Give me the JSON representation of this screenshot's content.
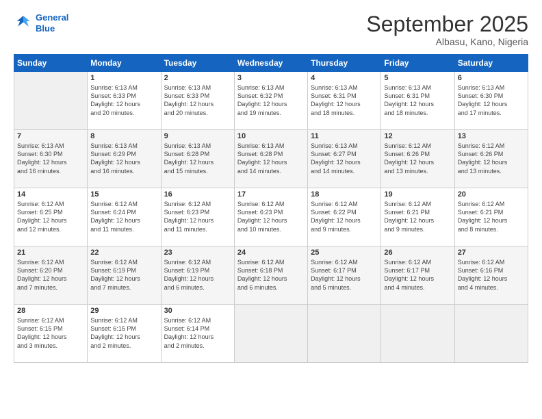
{
  "header": {
    "logo_line1": "General",
    "logo_line2": "Blue",
    "title": "September 2025",
    "location": "Albasu, Kano, Nigeria"
  },
  "days_of_week": [
    "Sunday",
    "Monday",
    "Tuesday",
    "Wednesday",
    "Thursday",
    "Friday",
    "Saturday"
  ],
  "weeks": [
    [
      {
        "day": "",
        "info": ""
      },
      {
        "day": "1",
        "info": "Sunrise: 6:13 AM\nSunset: 6:33 PM\nDaylight: 12 hours\nand 20 minutes."
      },
      {
        "day": "2",
        "info": "Sunrise: 6:13 AM\nSunset: 6:33 PM\nDaylight: 12 hours\nand 20 minutes."
      },
      {
        "day": "3",
        "info": "Sunrise: 6:13 AM\nSunset: 6:32 PM\nDaylight: 12 hours\nand 19 minutes."
      },
      {
        "day": "4",
        "info": "Sunrise: 6:13 AM\nSunset: 6:31 PM\nDaylight: 12 hours\nand 18 minutes."
      },
      {
        "day": "5",
        "info": "Sunrise: 6:13 AM\nSunset: 6:31 PM\nDaylight: 12 hours\nand 18 minutes."
      },
      {
        "day": "6",
        "info": "Sunrise: 6:13 AM\nSunset: 6:30 PM\nDaylight: 12 hours\nand 17 minutes."
      }
    ],
    [
      {
        "day": "7",
        "info": "Sunrise: 6:13 AM\nSunset: 6:30 PM\nDaylight: 12 hours\nand 16 minutes."
      },
      {
        "day": "8",
        "info": "Sunrise: 6:13 AM\nSunset: 6:29 PM\nDaylight: 12 hours\nand 16 minutes."
      },
      {
        "day": "9",
        "info": "Sunrise: 6:13 AM\nSunset: 6:28 PM\nDaylight: 12 hours\nand 15 minutes."
      },
      {
        "day": "10",
        "info": "Sunrise: 6:13 AM\nSunset: 6:28 PM\nDaylight: 12 hours\nand 14 minutes."
      },
      {
        "day": "11",
        "info": "Sunrise: 6:13 AM\nSunset: 6:27 PM\nDaylight: 12 hours\nand 14 minutes."
      },
      {
        "day": "12",
        "info": "Sunrise: 6:12 AM\nSunset: 6:26 PM\nDaylight: 12 hours\nand 13 minutes."
      },
      {
        "day": "13",
        "info": "Sunrise: 6:12 AM\nSunset: 6:26 PM\nDaylight: 12 hours\nand 13 minutes."
      }
    ],
    [
      {
        "day": "14",
        "info": "Sunrise: 6:12 AM\nSunset: 6:25 PM\nDaylight: 12 hours\nand 12 minutes."
      },
      {
        "day": "15",
        "info": "Sunrise: 6:12 AM\nSunset: 6:24 PM\nDaylight: 12 hours\nand 11 minutes."
      },
      {
        "day": "16",
        "info": "Sunrise: 6:12 AM\nSunset: 6:23 PM\nDaylight: 12 hours\nand 11 minutes."
      },
      {
        "day": "17",
        "info": "Sunrise: 6:12 AM\nSunset: 6:23 PM\nDaylight: 12 hours\nand 10 minutes."
      },
      {
        "day": "18",
        "info": "Sunrise: 6:12 AM\nSunset: 6:22 PM\nDaylight: 12 hours\nand 9 minutes."
      },
      {
        "day": "19",
        "info": "Sunrise: 6:12 AM\nSunset: 6:21 PM\nDaylight: 12 hours\nand 9 minutes."
      },
      {
        "day": "20",
        "info": "Sunrise: 6:12 AM\nSunset: 6:21 PM\nDaylight: 12 hours\nand 8 minutes."
      }
    ],
    [
      {
        "day": "21",
        "info": "Sunrise: 6:12 AM\nSunset: 6:20 PM\nDaylight: 12 hours\nand 7 minutes."
      },
      {
        "day": "22",
        "info": "Sunrise: 6:12 AM\nSunset: 6:19 PM\nDaylight: 12 hours\nand 7 minutes."
      },
      {
        "day": "23",
        "info": "Sunrise: 6:12 AM\nSunset: 6:19 PM\nDaylight: 12 hours\nand 6 minutes."
      },
      {
        "day": "24",
        "info": "Sunrise: 6:12 AM\nSunset: 6:18 PM\nDaylight: 12 hours\nand 6 minutes."
      },
      {
        "day": "25",
        "info": "Sunrise: 6:12 AM\nSunset: 6:17 PM\nDaylight: 12 hours\nand 5 minutes."
      },
      {
        "day": "26",
        "info": "Sunrise: 6:12 AM\nSunset: 6:17 PM\nDaylight: 12 hours\nand 4 minutes."
      },
      {
        "day": "27",
        "info": "Sunrise: 6:12 AM\nSunset: 6:16 PM\nDaylight: 12 hours\nand 4 minutes."
      }
    ],
    [
      {
        "day": "28",
        "info": "Sunrise: 6:12 AM\nSunset: 6:15 PM\nDaylight: 12 hours\nand 3 minutes."
      },
      {
        "day": "29",
        "info": "Sunrise: 6:12 AM\nSunset: 6:15 PM\nDaylight: 12 hours\nand 2 minutes."
      },
      {
        "day": "30",
        "info": "Sunrise: 6:12 AM\nSunset: 6:14 PM\nDaylight: 12 hours\nand 2 minutes."
      },
      {
        "day": "",
        "info": ""
      },
      {
        "day": "",
        "info": ""
      },
      {
        "day": "",
        "info": ""
      },
      {
        "day": "",
        "info": ""
      }
    ]
  ]
}
